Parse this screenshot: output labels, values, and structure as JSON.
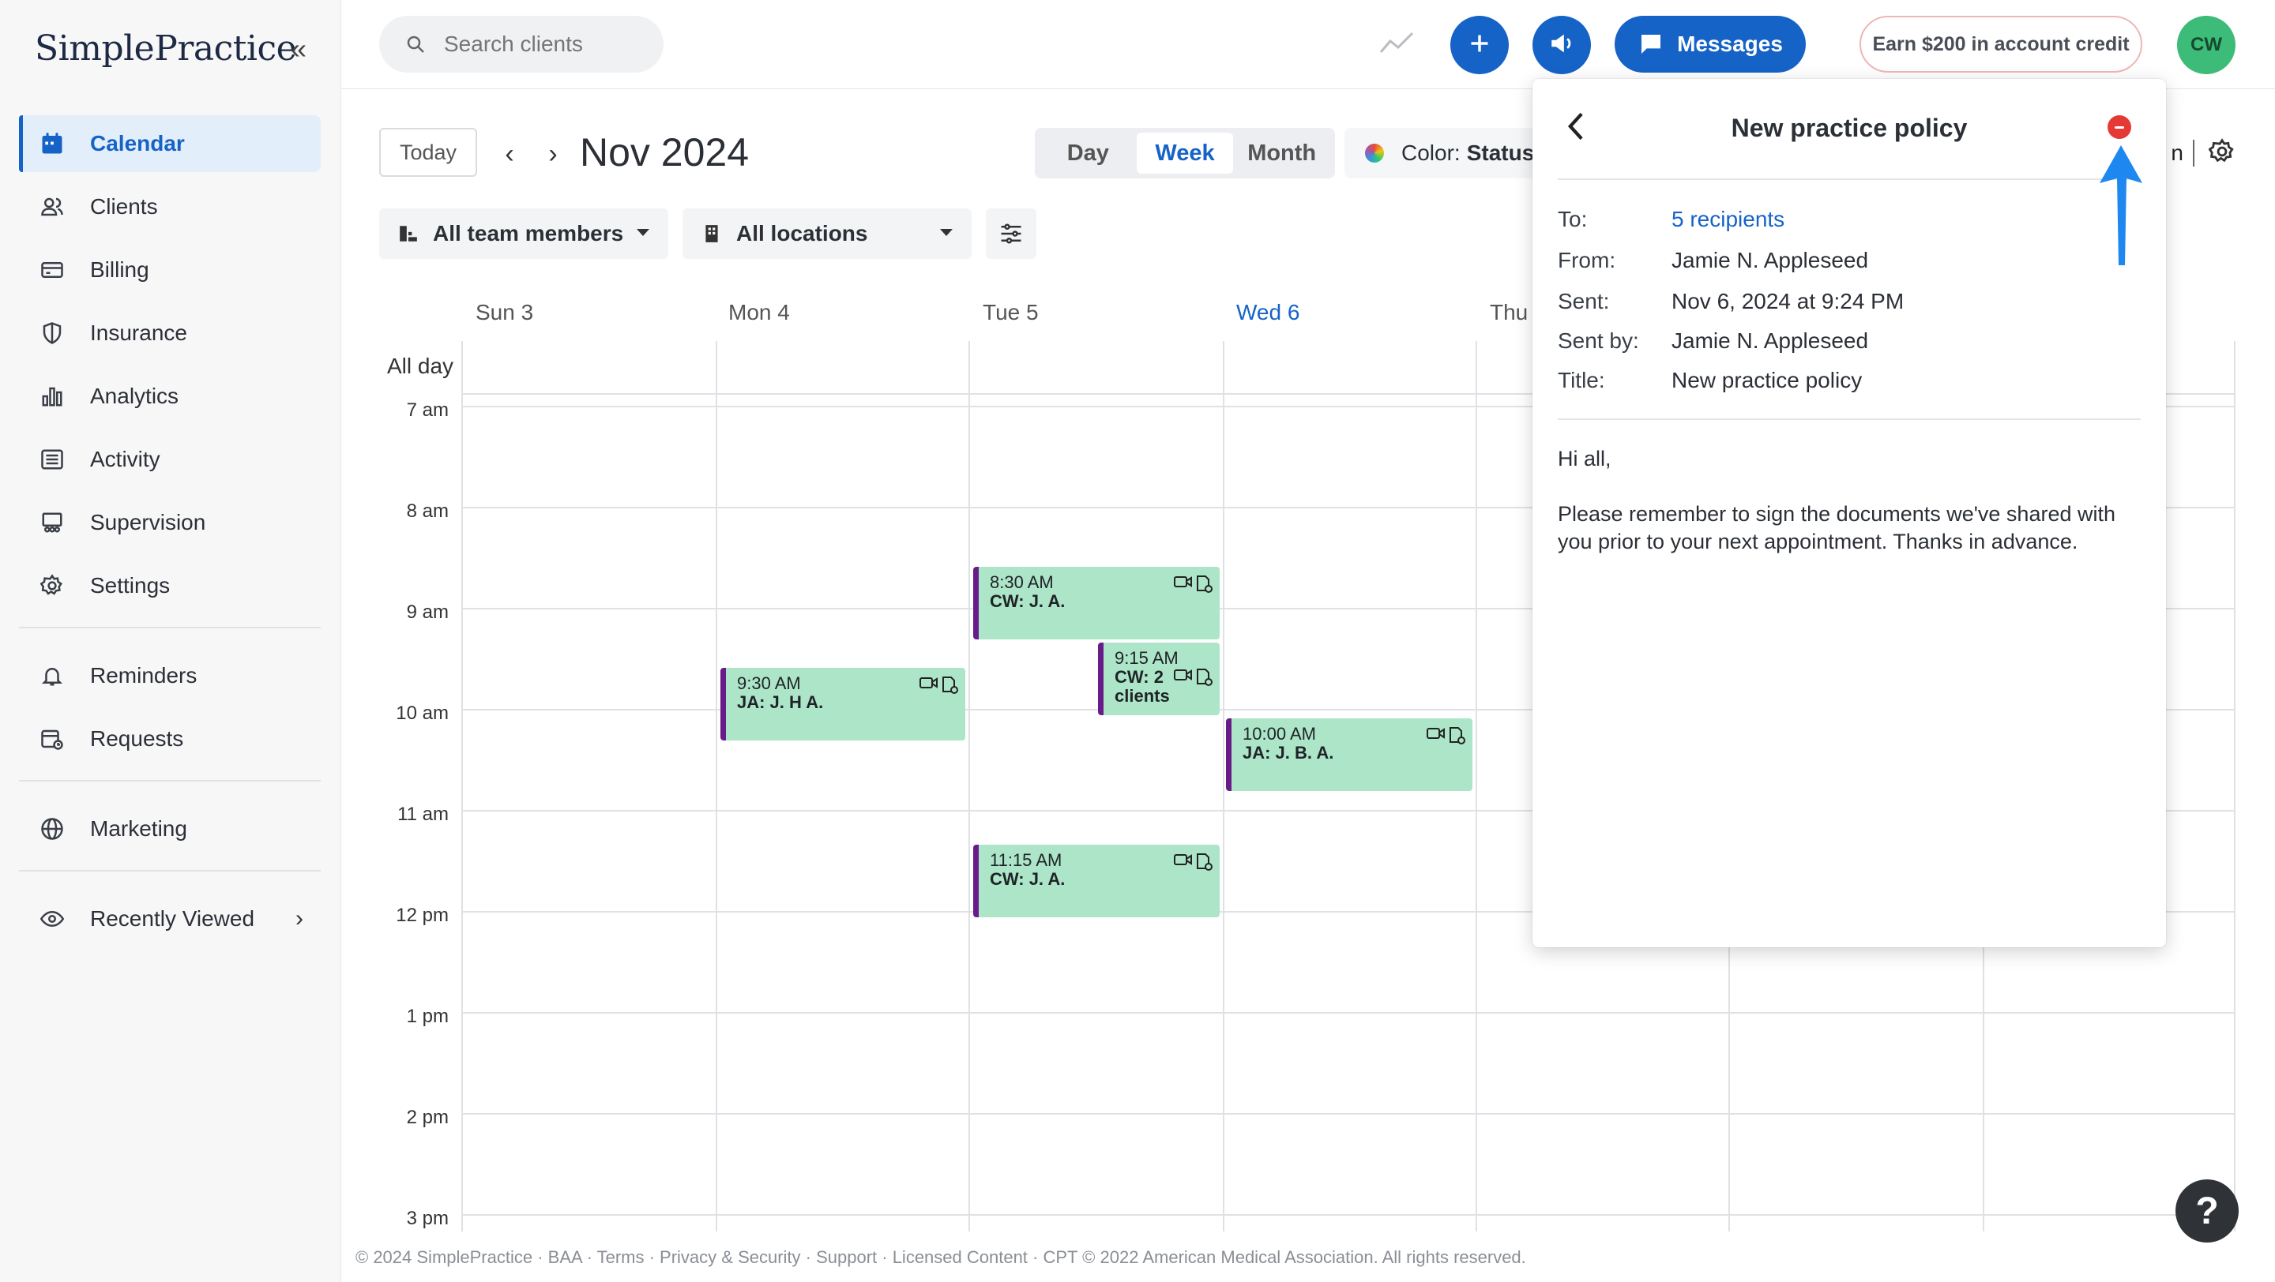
{
  "sidebar": {
    "logo": "SimplePractice",
    "collapse_icon": "double-chevron-left-icon",
    "items": [
      {
        "label": "Calendar",
        "icon": "calendar-icon",
        "active": true
      },
      {
        "label": "Clients",
        "icon": "clients-icon"
      },
      {
        "label": "Billing",
        "icon": "billing-icon"
      },
      {
        "label": "Insurance",
        "icon": "shield-icon"
      },
      {
        "label": "Analytics",
        "icon": "bar-chart-icon"
      },
      {
        "label": "Activity",
        "icon": "activity-icon"
      },
      {
        "label": "Supervision",
        "icon": "supervision-icon"
      },
      {
        "label": "Settings",
        "icon": "gear-icon"
      }
    ],
    "items2": [
      {
        "label": "Reminders",
        "icon": "bell-icon"
      },
      {
        "label": "Requests",
        "icon": "calendar-request-icon"
      }
    ],
    "items3": [
      {
        "label": "Marketing",
        "icon": "globe-icon"
      }
    ],
    "recently_viewed": {
      "label": "Recently Viewed",
      "icon": "eye-icon"
    }
  },
  "topbar": {
    "search_placeholder": "Search clients",
    "messages_label": "Messages",
    "credit_label": "Earn $200 in account credit",
    "avatar_initials": "CW"
  },
  "calendar": {
    "today_label": "Today",
    "month_title": "Nov 2024",
    "views": [
      "Day",
      "Week",
      "Month"
    ],
    "selected_view": "Week",
    "color_label": "Color:",
    "color_value": "Status",
    "partial_text": "n",
    "filter_team": "All team members",
    "filter_locations": "All locations",
    "all_day_label": "All day",
    "days": [
      {
        "label": "Sun 3"
      },
      {
        "label": "Mon 4"
      },
      {
        "label": "Tue 5"
      },
      {
        "label": "Wed 6",
        "today": true
      },
      {
        "label": "Thu"
      }
    ],
    "hours": [
      "7 am",
      "8 am",
      "9 am",
      "10 am",
      "11 am",
      "12 pm",
      "1 pm",
      "2 pm",
      "3 pm"
    ],
    "appointments": [
      {
        "time": "9:30 AM",
        "client": "JA: J. H A."
      },
      {
        "time": "8:30 AM",
        "client": "CW: J. A."
      },
      {
        "time": "9:15 AM",
        "client": "CW: 2",
        "client2": "clients"
      },
      {
        "time": "10:00 AM",
        "client": "JA: J. B. A."
      },
      {
        "time": "11:15 AM",
        "client": "CW: J. A."
      }
    ]
  },
  "footer": "© 2024 SimplePractice · BAA · Terms · Privacy & Security · Support · Licensed Content · CPT © 2022 American Medical Association. All rights reserved.",
  "help_label": "?",
  "message_panel": {
    "title": "New practice policy",
    "to_label": "To:",
    "to_value": "5 recipients",
    "from_label": "From:",
    "from_value": "Jamie N. Appleseed",
    "sent_label": "Sent:",
    "sent_value": "Nov 6, 2024 at 9:24 PM",
    "sentby_label": "Sent by:",
    "sentby_value": "Jamie N. Appleseed",
    "title_label": "Title:",
    "title_value": "New practice policy",
    "body_greeting": "Hi all,",
    "body_text": "Please remember to sign the documents we've shared with you prior to your next appointment. Thanks in advance."
  },
  "colors": {
    "accent": "#1663c7",
    "appointment_bg": "#ace5c7",
    "appointment_border": "#6a1b8a",
    "close_red": "#e53935",
    "avatar_green": "#3dbb79"
  }
}
